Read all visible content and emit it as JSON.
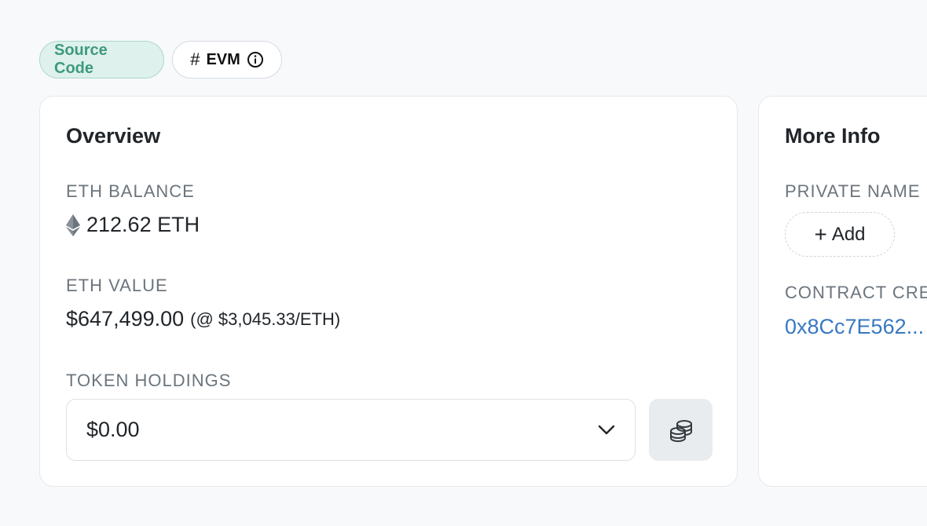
{
  "tags": {
    "source_code": "Source Code",
    "evm_hash": "#",
    "evm_label": "EVM"
  },
  "overview": {
    "title": "Overview",
    "eth_balance_label": "ETH BALANCE",
    "eth_balance_value": "212.62 ETH",
    "eth_value_label": "ETH VALUE",
    "eth_value_amount": "$647,499.00",
    "eth_value_rate": "(@ $3,045.33/ETH)",
    "token_holdings_label": "TOKEN HOLDINGS",
    "token_holdings_value": "$0.00"
  },
  "more_info": {
    "title": "More Info",
    "private_name_label": "PRIVATE NAME",
    "add_label": "Add",
    "contract_creator_label": "CONTRACT CRE",
    "contract_creator_value": "0x8Cc7E562..."
  },
  "colors": {
    "source_chip_bg": "#dff1ec",
    "source_chip_text": "#3e9a7d",
    "link": "#3878c2"
  }
}
